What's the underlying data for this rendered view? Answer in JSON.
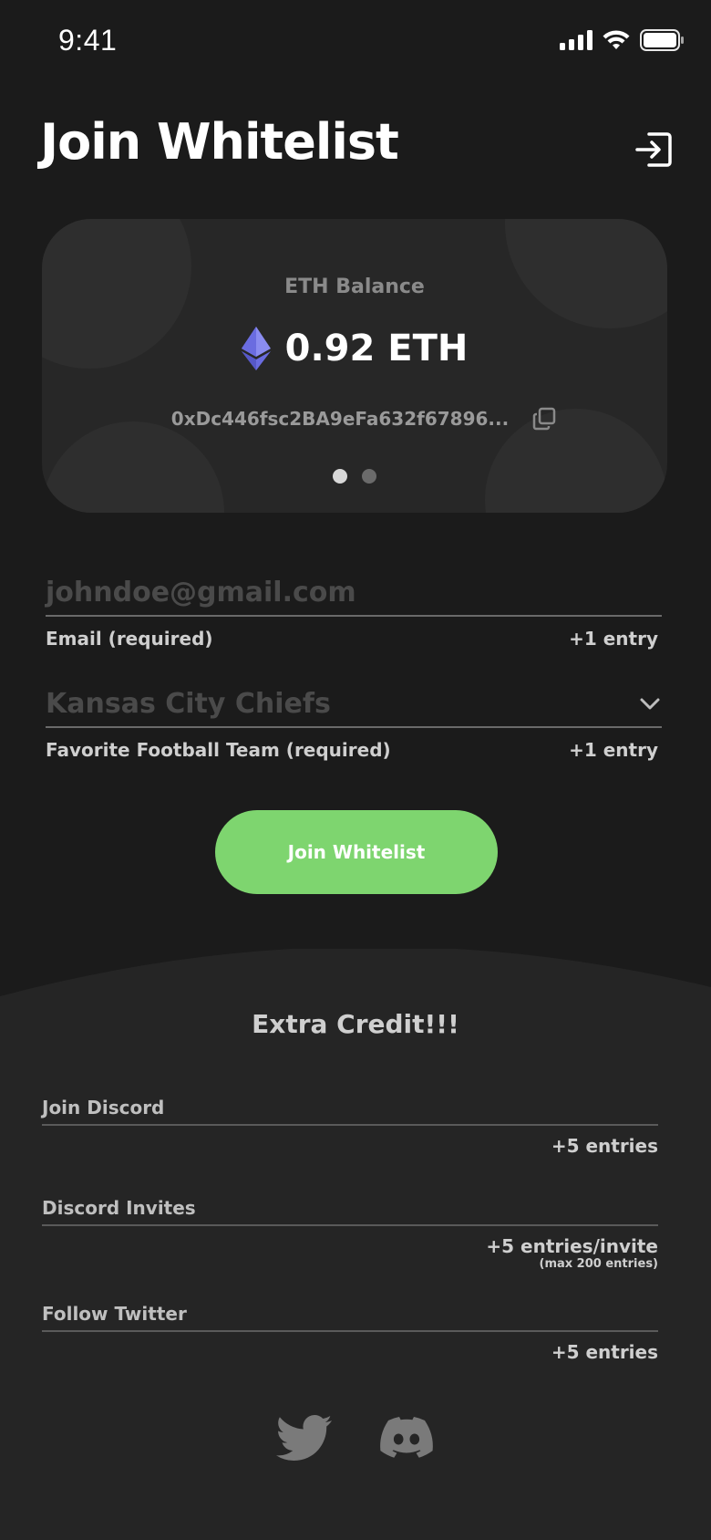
{
  "status_bar": {
    "time": "9:41"
  },
  "header": {
    "title": "Join Whitelist"
  },
  "balance_card": {
    "label": "ETH Balance",
    "amount": "0.92 ETH",
    "address": "0xDc446fsc2BA9eFa632f67896...",
    "pager_total": 2,
    "pager_active": 1
  },
  "form": {
    "email": {
      "placeholder": "johndoe@gmail.com",
      "label": "Email (required)",
      "entry": "+1 entry"
    },
    "team": {
      "value": "Kansas City Chiefs",
      "label": "Favorite Football Team (required)",
      "entry": "+1 entry"
    },
    "submit_label": "Join Whitelist"
  },
  "extra_credit": {
    "title": "Extra Credit!!!",
    "tasks": [
      {
        "label": "Join Discord",
        "entry": "+5 entries"
      },
      {
        "label": "Discord Invites",
        "entry": "+5 entries/invite",
        "note": "(max 200 entries)"
      },
      {
        "label": "Follow Twitter",
        "entry": "+5 entries"
      }
    ]
  },
  "social": {
    "icons": [
      "twitter-icon",
      "discord-icon"
    ]
  },
  "colors": {
    "background": "#1b1b1b",
    "card": "#272727",
    "accent_green": "#7ed56f",
    "eth_purple": "#6a6ce0"
  }
}
